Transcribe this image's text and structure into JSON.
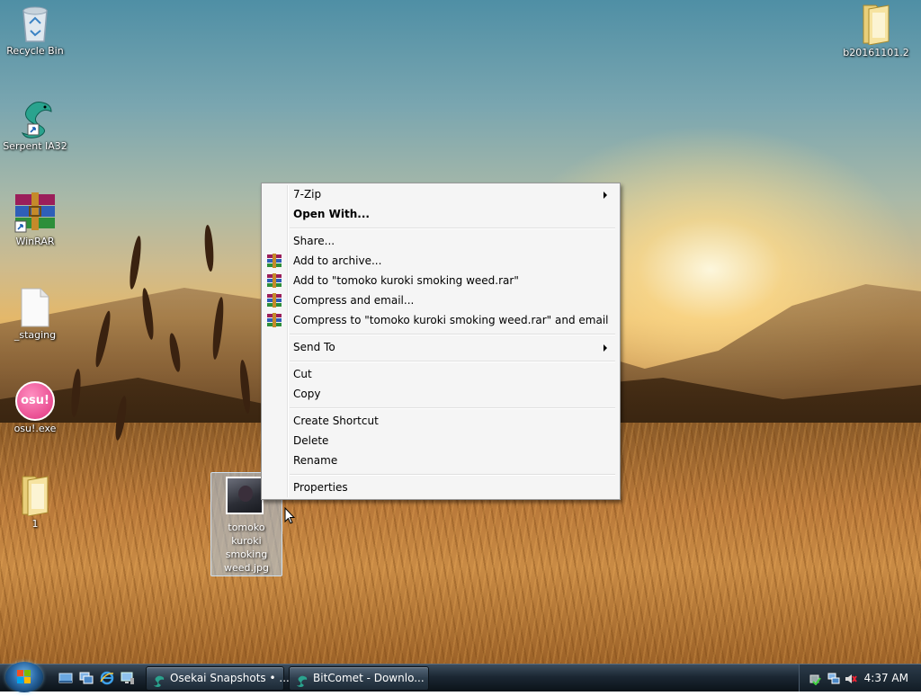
{
  "desktop": {
    "icons": [
      {
        "label": "Recycle Bin",
        "icon": "recycle-bin-icon"
      },
      {
        "label": "Serpent IA32",
        "icon": "serpent-icon"
      },
      {
        "label": "WinRAR",
        "icon": "winrar-icon"
      },
      {
        "label": "_staging",
        "icon": "document-icon"
      },
      {
        "label": "osu!.exe",
        "icon": "osu-icon",
        "badge": "osu!"
      },
      {
        "label": "1",
        "icon": "folder-icon"
      },
      {
        "label": "b20161101.2",
        "icon": "folder-icon"
      }
    ],
    "selected_file": {
      "label": "tomoko kuroki smoking weed.jpg",
      "label_lines": [
        "tomoko",
        "kuroki",
        "smoking",
        "weed.jpg"
      ],
      "icon": "image-thumbnail-icon"
    }
  },
  "context_menu": {
    "items": [
      {
        "label": "7-Zip",
        "submenu": true
      },
      {
        "label": "Open With...",
        "bold": true
      },
      {
        "label": "Share..."
      },
      {
        "label": "Add to archive...",
        "icon": "winrar-icon"
      },
      {
        "label": "Add to \"tomoko kuroki smoking weed.rar\"",
        "icon": "winrar-icon"
      },
      {
        "label": "Compress and email...",
        "icon": "winrar-icon"
      },
      {
        "label": "Compress to \"tomoko kuroki smoking weed.rar\" and email",
        "icon": "winrar-icon"
      },
      {
        "label": "Send To",
        "submenu": true
      },
      {
        "label": "Cut"
      },
      {
        "label": "Copy"
      },
      {
        "label": "Create Shortcut"
      },
      {
        "label": "Delete"
      },
      {
        "label": "Rename"
      },
      {
        "label": "Properties"
      }
    ]
  },
  "taskbar": {
    "quick_launch": [
      "show-desktop-icon",
      "switch-windows-icon",
      "internet-explorer-icon",
      "computer-icon"
    ],
    "buttons": [
      {
        "label": "Osekai Snapshots • ...",
        "icon": "serpent-icon"
      },
      {
        "label": "BitComet - Downlo...",
        "icon": "bitcomet-icon"
      }
    ],
    "tray_icons": [
      "safely-remove-icon",
      "network-icon",
      "volume-muted-icon"
    ],
    "clock": "4:37 AM"
  }
}
